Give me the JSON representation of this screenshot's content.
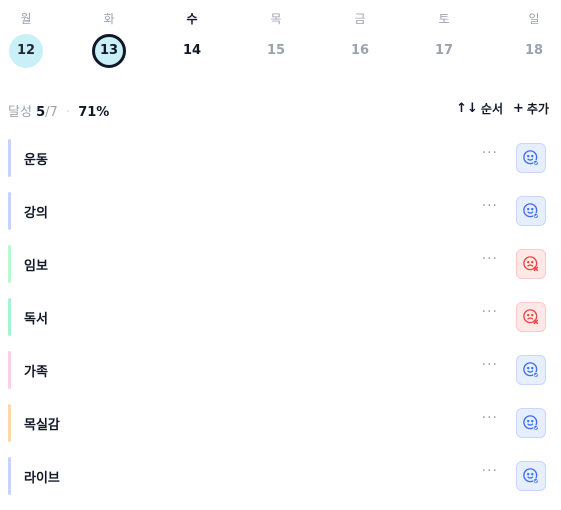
{
  "week": [
    {
      "dow": "월",
      "date": "12",
      "state": "past"
    },
    {
      "dow": "화",
      "date": "13",
      "state": "selected"
    },
    {
      "dow": "수",
      "date": "14",
      "state": "today"
    },
    {
      "dow": "목",
      "date": "15",
      "state": "future"
    },
    {
      "dow": "금",
      "date": "16",
      "state": "future"
    },
    {
      "dow": "토",
      "date": "17",
      "state": "future"
    },
    {
      "dow": "일",
      "date": "18",
      "state": "future"
    }
  ],
  "summary": {
    "label": "달성",
    "done": "5",
    "total": "/7",
    "sep": "·",
    "percent": "71%"
  },
  "actions": {
    "order_icon": "↑↓",
    "order_label": "순서",
    "add_icon": "+",
    "add_label": "추가"
  },
  "more_label": "···",
  "habits": [
    {
      "label": "운동",
      "status": "ok",
      "accent": "#c7d2fe"
    },
    {
      "label": "강의",
      "status": "ok",
      "accent": "#c7d2fe"
    },
    {
      "label": "임보",
      "status": "fail",
      "accent": "#bbf7d0"
    },
    {
      "label": "독서",
      "status": "fail",
      "accent": "#a7f3d0"
    },
    {
      "label": "가족",
      "status": "ok",
      "accent": "#fbcfe8"
    },
    {
      "label": "목실감",
      "status": "ok",
      "accent": "#fed7aa"
    },
    {
      "label": "라이브",
      "status": "ok",
      "accent": "#c7d2fe"
    }
  ],
  "colors": {
    "ok": "#3b6ef5",
    "fail": "#ef4444",
    "highlight": "#c9f0f7"
  }
}
